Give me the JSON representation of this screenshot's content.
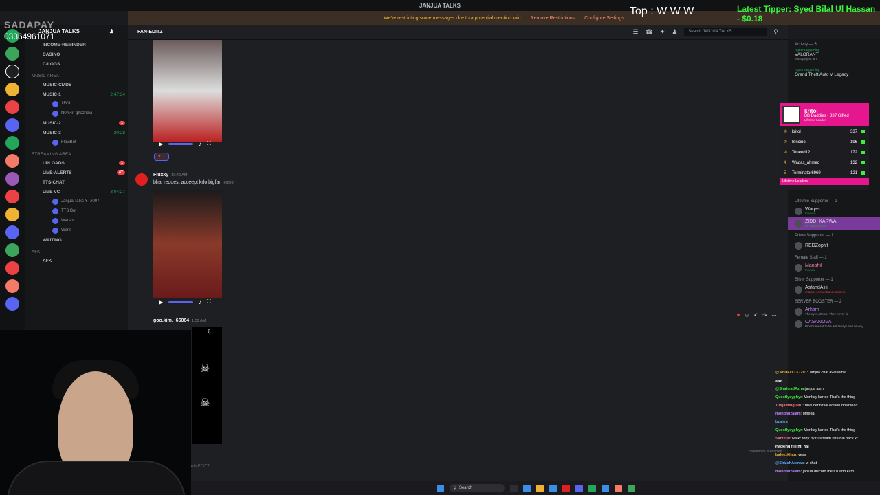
{
  "window": {
    "title": "JANJUA TALKS",
    "banner_text": "We're restricting some messages due to a potential mention raid",
    "banner_remove": "Remove Restrictions",
    "banner_configure": "Configure Settings"
  },
  "server": {
    "name": "JANJUA TALKS",
    "channels": [
      {
        "name": "income-reminder"
      },
      {
        "name": "casino"
      },
      {
        "name": "c-logs"
      }
    ],
    "music_category": "MUSIC AREA",
    "music_channels": [
      {
        "name": "music-cmds",
        "meta": ""
      },
      {
        "name": "music-1",
        "meta": "2:47:34"
      },
      {
        "name": "music-2",
        "meta": "1"
      },
      {
        "name": "music-3",
        "meta": "20:28"
      }
    ],
    "music_users": [
      {
        "name": "1FOL"
      },
      {
        "name": "N0m4n ghaznavi"
      },
      {
        "name": "FlaviBot"
      }
    ],
    "streaming_category": "STREAMING AREA",
    "streaming_channels": [
      {
        "name": "uploads",
        "meta": "1"
      },
      {
        "name": "live-alerts",
        "meta": "47"
      },
      {
        "name": "tts-chat",
        "meta": ""
      },
      {
        "name": "live vc",
        "meta": "3:04:27"
      }
    ],
    "live_users": [
      {
        "name": "Janjua Talks YT#007"
      },
      {
        "name": "TTS Bot"
      },
      {
        "name": "Waqas"
      },
      {
        "name": "Waris"
      }
    ],
    "afk_category": "AFK",
    "other_channels": [
      {
        "name": "waiting"
      },
      {
        "name": "afk"
      }
    ]
  },
  "chat": {
    "channel_name": "FAN-EDITZ",
    "search_placeholder": "Search JANJUA TALKS",
    "reaction_count": "1",
    "message1": {
      "author": "Fluxxy",
      "time": "10:42 AM",
      "text": "bhai request acceept krlo bigfan",
      "edited": "(edited)"
    },
    "message2": {
      "author": "goo.kim._66064",
      "time": "1:59 AM"
    },
    "composer_placeholder": "FAN-EDITZ",
    "slowmode": "Slowmode is enabled"
  },
  "members": {
    "activity_label": "Activity — 5",
    "activities": [
      {
        "user": "rapidroargaming",
        "game": "VALORANT",
        "sub": "Most played: 9h"
      },
      {
        "user": "rapidroargaming",
        "game": "Grand Theft Auto V Legacy",
        "sub": ""
      }
    ],
    "groups": [
      {
        "label": "Lifetime Supporter — 2",
        "items": [
          {
            "name": "Waqas",
            "sub": "In voice"
          },
          {
            "name": "ZIDDI KARWA",
            "sub": "AP ENGINEER"
          }
        ]
      },
      {
        "label": "Prime Supporter — 1",
        "items": [
          {
            "name": "REDZopYt",
            "sub": ""
          }
        ]
      },
      {
        "label": "Female Staff — 1",
        "items": [
          {
            "name": "Manahil",
            "sub": "In voice"
          }
        ]
      },
      {
        "label": "Silver Supporter — 1",
        "items": [
          {
            "name": "AsfandAliiii",
            "sub": "el amor encuentra un camino"
          }
        ]
      },
      {
        "label": "SERVER BOOSTER — 2",
        "items": [
          {
            "name": "Arham",
            "sub": "The eyes, Chico. They never lie"
          },
          {
            "name": "CASANOVA",
            "sub": "What's meant to be will always find its way"
          }
        ]
      }
    ]
  },
  "overlay": {
    "brand": "SADAPAY",
    "phone": "03364961071",
    "top_banner": "Top : W W W",
    "tipper_label": "Latest Tipper: Syed Bilal Ul Hassan - $0.18",
    "leaderboard": {
      "top_name": "kritol",
      "top_sub": "BB Daddies - 337 Gifted",
      "top_tag": "Lifetime Leader",
      "rows": [
        {
          "rank": "",
          "name": "kritol",
          "score": "337"
        },
        {
          "rank": "",
          "name": "Bincino",
          "score": "196"
        },
        {
          "rank": "",
          "name": "Teheed12",
          "score": "172"
        },
        {
          "rank": "4",
          "name": "Waqas_ahmed",
          "score": "132"
        },
        {
          "rank": "5",
          "name": "Terminator6969",
          "score": "121"
        }
      ],
      "footer": "Lifetime Leaders"
    },
    "chat_messages": [
      {
        "user": "@ABDEDITX7201",
        "text": ": Janjua chat awesome",
        "color": "#f0b232"
      },
      {
        "user": "say",
        "text": "",
        "color": "#ffffff"
      },
      {
        "user": "@ShahzadAzhar",
        "text": "janjua asmr",
        "color": "#3bf23b"
      },
      {
        "user": "Questlysyphyr",
        "text": ": Monkey kar do That's the thing",
        "color": "#3bf23b"
      },
      {
        "user": "Tufgaming0907",
        "text": ": bhai definitive edition download",
        "color": "#ff7b7b"
      },
      {
        "user": "mohdfaizalam",
        "text": ": omega",
        "color": "#c084fc"
      },
      {
        "user": "bzahra",
        "text": "",
        "color": "#60a5fa"
      },
      {
        "user": "Questlysyphyr",
        "text": ": Monkey kar do That's the thing",
        "color": "#3bf23b"
      },
      {
        "user": "Sarz200",
        "text": ": Na kr rehy dy tu stream krta hai hack kr",
        "color": "#ff7b7b"
      },
      {
        "user": "Hacking file hti hai",
        "text": "",
        "color": "#ffffff"
      },
      {
        "user": "bafeezkhan",
        "text": ": yess",
        "color": "#f0b232"
      },
      {
        "user": "@ShizahAsmaa",
        "text": ": w chat",
        "color": "#60a5fa"
      },
      {
        "user": "mohdfaizalam",
        "text": ": janjua discord me full add karo",
        "color": "#c084fc"
      }
    ]
  },
  "taskbar": {
    "search_label": "Search",
    "time": "",
    "date": ""
  },
  "colors": {
    "accent": "#5865f2",
    "danger": "#f23f42",
    "online": "#23a55a",
    "tipper": "#3bf23b",
    "leaderboard": "#e5168e"
  }
}
